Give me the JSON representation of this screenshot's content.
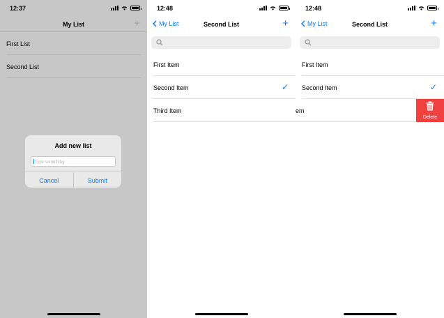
{
  "screen1": {
    "status_time": "12:37",
    "nav_title": "My List",
    "add_icon": "plus-icon",
    "lists": [
      {
        "label": "First List"
      },
      {
        "label": "Second List"
      }
    ],
    "alert": {
      "title": "Add new list",
      "placeholder": "Type something",
      "cancel_label": "Cancel",
      "submit_label": "Submit"
    }
  },
  "screen2": {
    "status_time": "12:48",
    "back_label": "My List",
    "nav_title": "Second List",
    "items": [
      {
        "label": "First Item",
        "checked": false
      },
      {
        "label": "Second Item",
        "checked": true
      },
      {
        "label": "Third Item",
        "checked": false
      }
    ]
  },
  "screen3": {
    "status_time": "12:48",
    "back_label": "My List",
    "nav_title": "Second List",
    "items": [
      {
        "label": "First Item",
        "checked": false
      },
      {
        "label": "Second Item",
        "checked": true
      },
      {
        "label": "em",
        "checked": false
      }
    ],
    "delete_label": "Delete"
  },
  "colors": {
    "accent": "#0a7cff",
    "delete": "#f04040",
    "dim_background": "#c7c7c7"
  }
}
